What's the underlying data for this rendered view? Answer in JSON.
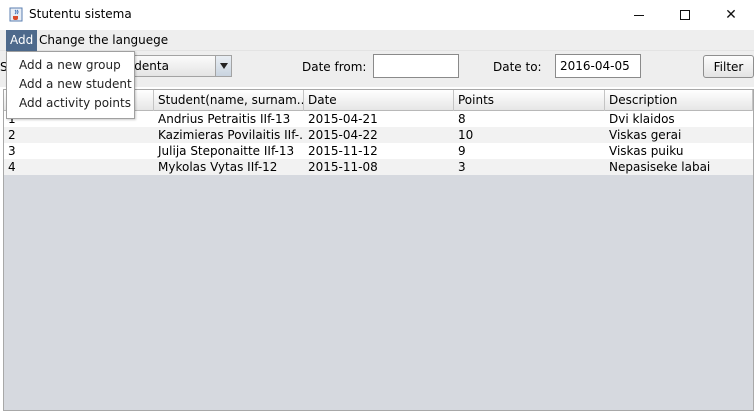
{
  "window": {
    "title": "Stutentu sistema",
    "icons": {
      "app": "java-cup-icon",
      "minimize": "minimize-icon",
      "maximize": "maximize-icon",
      "close": "close-icon"
    },
    "close_glyph": "✕"
  },
  "menubar": {
    "items": [
      {
        "label": "Add",
        "active": true
      },
      {
        "label": "Change the languege"
      }
    ]
  },
  "add_menu": {
    "items": [
      {
        "label": "Add a new group"
      },
      {
        "label": "Add a new student"
      },
      {
        "label": "Add activity points"
      }
    ]
  },
  "toolbar": {
    "select_label": "S",
    "student_combo_value": "tudenta",
    "date_from_label": "Date from:",
    "date_from_value": "",
    "date_to_label": "Date to:",
    "date_to_value": "2016-04-05",
    "filter_label": "Filter"
  },
  "table": {
    "columns": [
      "",
      "Student(name, surnam...",
      "Date",
      "Points",
      "Description"
    ],
    "rows": [
      [
        "1",
        "Andrius Petraitis IIf-13",
        "2015-04-21",
        "8",
        "Dvi klaidos"
      ],
      [
        "2",
        "Kazimieras Povilaitis IIf-...",
        "2015-04-22",
        "10",
        "Viskas gerai"
      ],
      [
        "3",
        "Julija Steponaitte IIf-13",
        "2015-11-12",
        "9",
        "Viskas puiku"
      ],
      [
        "4",
        "Mykolas Vytas IIf-12",
        "2015-11-08",
        "3",
        "Nepasiseke labai"
      ]
    ]
  },
  "colors": {
    "menu_active_bg": "#4e6a8c",
    "table_empty_bg": "#d6d9df",
    "chrome_bg": "#eeeeee"
  }
}
